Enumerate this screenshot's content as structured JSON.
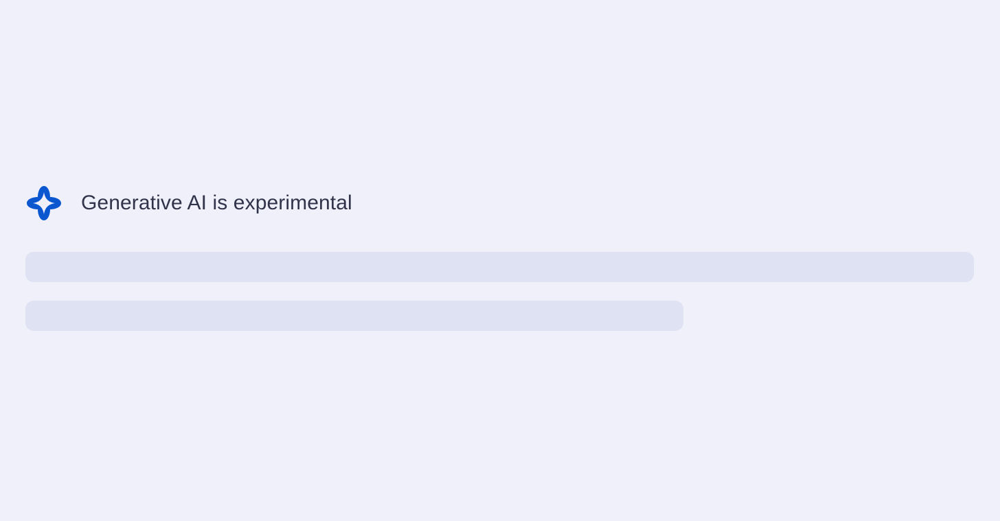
{
  "header": {
    "icon": "sparkle-icon",
    "title": "Generative AI is experimental"
  },
  "colors": {
    "background": "#eff0f9",
    "icon_blue": "#0b57d0",
    "title_text": "#303349",
    "skeleton": "#dfe2f2"
  },
  "skeleton_lines": 2
}
